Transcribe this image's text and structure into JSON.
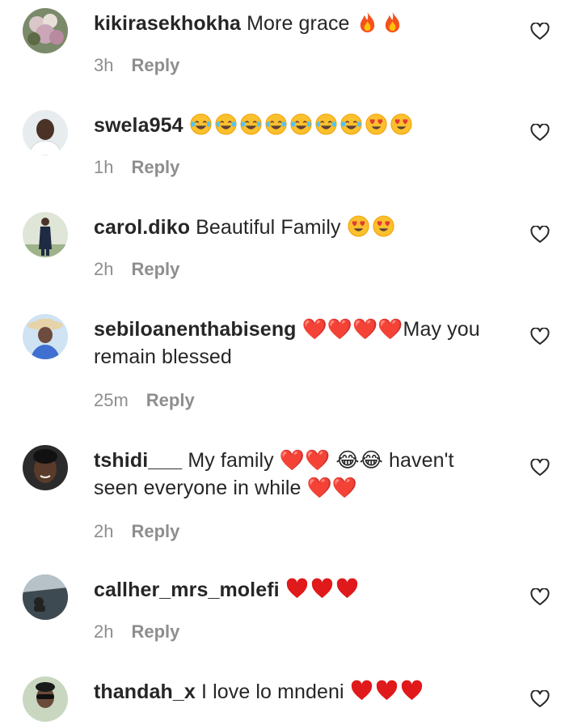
{
  "comments": [
    {
      "username": "kikirasekhokha",
      "text": "More grace",
      "emojis": "🔥🔥",
      "emoji_types": [
        "fire",
        "fire"
      ],
      "time": "3h",
      "reply": "Reply"
    },
    {
      "username": "swela954",
      "text": "",
      "emojis": "😂😂😂😂😂😂😂😍😍",
      "emoji_types": [
        "joy",
        "joy",
        "joy",
        "joy",
        "joy",
        "joy",
        "joy",
        "hearteyes",
        "hearteyes"
      ],
      "time": "1h",
      "reply": "Reply"
    },
    {
      "username": "carol.diko",
      "text": "Beautiful Family",
      "emojis": "😍😍",
      "emoji_types": [
        "hearteyes",
        "hearteyes"
      ],
      "time": "2h",
      "reply": "Reply"
    },
    {
      "username": "sebiloanenthabiseng",
      "text": "❤️❤️❤️❤️May you remain blessed",
      "time": "25m",
      "reply": "Reply"
    },
    {
      "username": "tshidi___",
      "text": "My family ❤️❤️ 😂😂 haven't seen everyone in while ❤️❤️",
      "time": "2h",
      "reply": "Reply"
    },
    {
      "username": "callher_mrs_molefi",
      "text": "",
      "emojis": "❤️❤️❤️",
      "emoji_types": [
        "heart",
        "heart",
        "heart"
      ],
      "time": "2h",
      "reply": "Reply"
    },
    {
      "username": "thandah_x",
      "text": "I love lo mndeni",
      "emojis": "❤️❤️❤️",
      "emoji_types": [
        "heart",
        "heart",
        "heart"
      ],
      "time": "",
      "reply": ""
    }
  ],
  "colors": {
    "text": "#262626",
    "meta": "#8e8e8e",
    "heart_outline": "#262626"
  },
  "icons": {
    "like": "heart-outline-icon"
  }
}
